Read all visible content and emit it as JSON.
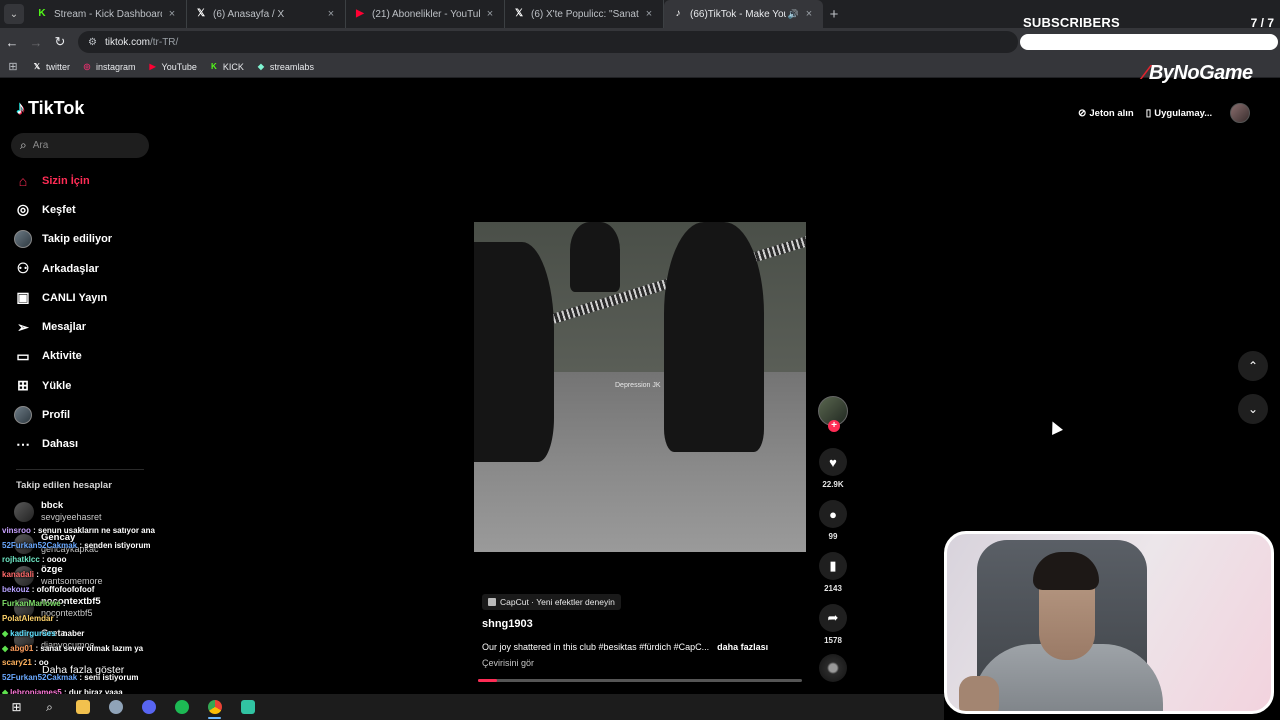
{
  "browser": {
    "tabs": [
      {
        "title": "Stream - Kick Dashboard",
        "color": "#53fc18",
        "icon": "kick-icon",
        "glyph": "K",
        "active": false
      },
      {
        "title": "(6) Anasayfa / X",
        "color": "#ffffff",
        "icon": "x-logo-icon",
        "glyph": "𝕏",
        "active": false
      },
      {
        "title": "(21) Abonelikler - YouTube",
        "color": "#ff0033",
        "icon": "youtube-icon",
        "glyph": "▶",
        "active": false
      },
      {
        "title": "(6) X'te Populicc: \"Sanatçıların y",
        "color": "#ffffff",
        "icon": "x-logo-icon",
        "glyph": "𝕏",
        "active": false
      },
      {
        "title": "(66)TikTok - Make Your Day",
        "color": "#ffffff",
        "icon": "tiktok-icon",
        "glyph": "♪",
        "active": true
      }
    ],
    "url_host": "tiktok.com",
    "url_path": "/tr-TR/",
    "bookmarks": [
      {
        "label": "twitter",
        "icon": "x-logo-icon",
        "glyph": "𝕏",
        "color": "#ffffff"
      },
      {
        "label": "instagram",
        "icon": "instagram-icon",
        "glyph": "◎",
        "color": "#e1306c"
      },
      {
        "label": "YouTube",
        "icon": "youtube-icon",
        "glyph": "▶",
        "color": "#ff0033"
      },
      {
        "label": "KICK",
        "icon": "kick-icon",
        "glyph": "K",
        "color": "#53fc18"
      },
      {
        "label": "streamlabs",
        "icon": "streamlabs-icon",
        "glyph": "◆",
        "color": "#80f5d2"
      }
    ]
  },
  "overlay": {
    "subscribers_label": "SUBSCRIBERS",
    "subscribers_count": "7 / 7",
    "subscribers_progress": 1.0,
    "brand": "ByNoGame"
  },
  "tiktok": {
    "logo": "TikTok",
    "search_placeholder": "Ara",
    "nav": [
      {
        "label": "Sizin İçin",
        "icon": "home-icon",
        "glyph": "⌂",
        "active": true,
        "badge": ""
      },
      {
        "label": "Keşfet",
        "icon": "compass-icon",
        "glyph": "◎",
        "active": false,
        "badge": ""
      },
      {
        "label": "Takip ediliyor",
        "icon": "following-avatar-icon",
        "glyph": "",
        "active": false,
        "badge": ""
      },
      {
        "label": "Arkadaşlar",
        "icon": "friends-icon",
        "glyph": "⚇",
        "active": false,
        "badge": ""
      },
      {
        "label": "CANLI Yayın",
        "icon": "live-tv-icon",
        "glyph": "▣",
        "active": false,
        "badge": ""
      },
      {
        "label": "Mesajlar",
        "icon": "messages-icon",
        "glyph": "➢",
        "active": false,
        "badge": "4"
      },
      {
        "label": "Aktivite",
        "icon": "activity-icon",
        "glyph": "▭",
        "active": false,
        "badge": "62"
      },
      {
        "label": "Yükle",
        "icon": "upload-icon",
        "glyph": "⊞",
        "active": false,
        "badge": ""
      },
      {
        "label": "Profil",
        "icon": "profile-avatar-icon",
        "glyph": "",
        "active": false,
        "badge": ""
      },
      {
        "label": "Dahası",
        "icon": "more-dots-icon",
        "glyph": "⋯",
        "active": false,
        "badge": ""
      }
    ],
    "followed_title": "Takip edilen hesaplar",
    "followed": [
      {
        "user": "bbck",
        "name": "sevgiyeehasret"
      },
      {
        "user": "Gencay",
        "name": "gencaykapkac"
      },
      {
        "user": "özge",
        "name": "wantsomemore"
      },
      {
        "user": "nocontextbf5",
        "name": "nocontextbf5"
      },
      {
        "user": "Greta",
        "name": "dianyocumoe"
      }
    ],
    "more_link": "Daha fazla göster",
    "header": {
      "coins": "Jeton alın",
      "app": "Uygulamay..."
    },
    "video": {
      "watermark": "Depression JK",
      "progress": 0.06
    },
    "cta": "CapCut · Yeni efektler deneyin",
    "author": "shng1903",
    "caption": "Our joy shattered in this club #besiktas #fürdich #CapC...",
    "caption_more": "daha fazlası",
    "translate": "Çevirisini gör",
    "actions": {
      "likes": "22.9K",
      "comments": "99",
      "saves": "2143",
      "shares": "1578"
    }
  },
  "chat": [
    {
      "user": "vinsroo",
      "color": "#c8a2ff",
      "msg": "senun usakların ne satıyor ana",
      "gem": false
    },
    {
      "user": "52Furkan52Cakmak",
      "color": "#6aa9ff",
      "msg": "senden istiyorum",
      "gem": false
    },
    {
      "user": "rojhatklcc",
      "color": "#6ee7c4",
      "msg": "oooo",
      "gem": false
    },
    {
      "user": "kanadali",
      "color": "#ff6a6a",
      "msg": "",
      "gem": false
    },
    {
      "user": "bekouz",
      "color": "#b7a1ff",
      "msg": "ofoffofoofofoof",
      "gem": false
    },
    {
      "user": "FurkanMarlowe",
      "color": "#7fe06a",
      "msg": "",
      "gem": false
    },
    {
      "user": "PolatAlemdar",
      "color": "#ffd36a",
      "msg": "",
      "gem": false
    },
    {
      "user": "kadirgurses",
      "color": "#5ee1ff",
      "msg": "naber",
      "gem": true
    },
    {
      "user": "abg01",
      "color": "#ff9f5e",
      "msg": "sanat sever olmak lazım ya",
      "gem": true
    },
    {
      "user": "scary21",
      "color": "#ffb35e",
      "msg": "oo",
      "gem": false
    },
    {
      "user": "52Furkan52Cakmak",
      "color": "#6aa9ff",
      "msg": "seni istiyorum",
      "gem": false
    },
    {
      "user": "lebronjames5",
      "color": "#ff7ad9",
      "msg": "dur biraz yaaa",
      "gem": true
    }
  ]
}
